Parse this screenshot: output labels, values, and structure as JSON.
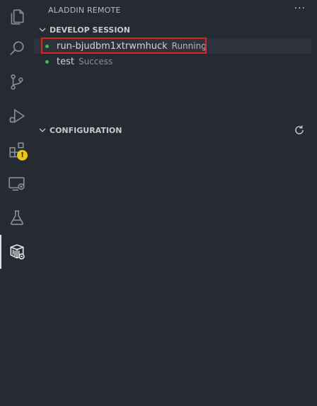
{
  "sidebar": {
    "title": "ALADDIN REMOTE",
    "more_actions": "···",
    "sections": [
      {
        "label": "DEVELOP SESSION",
        "items": [
          {
            "name": "run-bjudbm1xtrwmhuck",
            "status": "Running"
          },
          {
            "name": "test",
            "status": "Success"
          }
        ]
      },
      {
        "label": "CONFIGURATION"
      }
    ]
  },
  "activity_bar": {
    "items": [
      {
        "icon": "explorer-icon"
      },
      {
        "icon": "search-icon"
      },
      {
        "icon": "source-control-icon"
      },
      {
        "icon": "run-debug-icon"
      },
      {
        "icon": "extensions-icon",
        "badge": "!"
      },
      {
        "icon": "remote-explorer-icon"
      },
      {
        "icon": "testing-icon"
      },
      {
        "icon": "aladdin-remote-icon",
        "active": true
      }
    ]
  },
  "colors": {
    "background": "#262a33",
    "status_running": "#3fb950",
    "highlight": "#e02424",
    "badge": "#e8c51a"
  }
}
